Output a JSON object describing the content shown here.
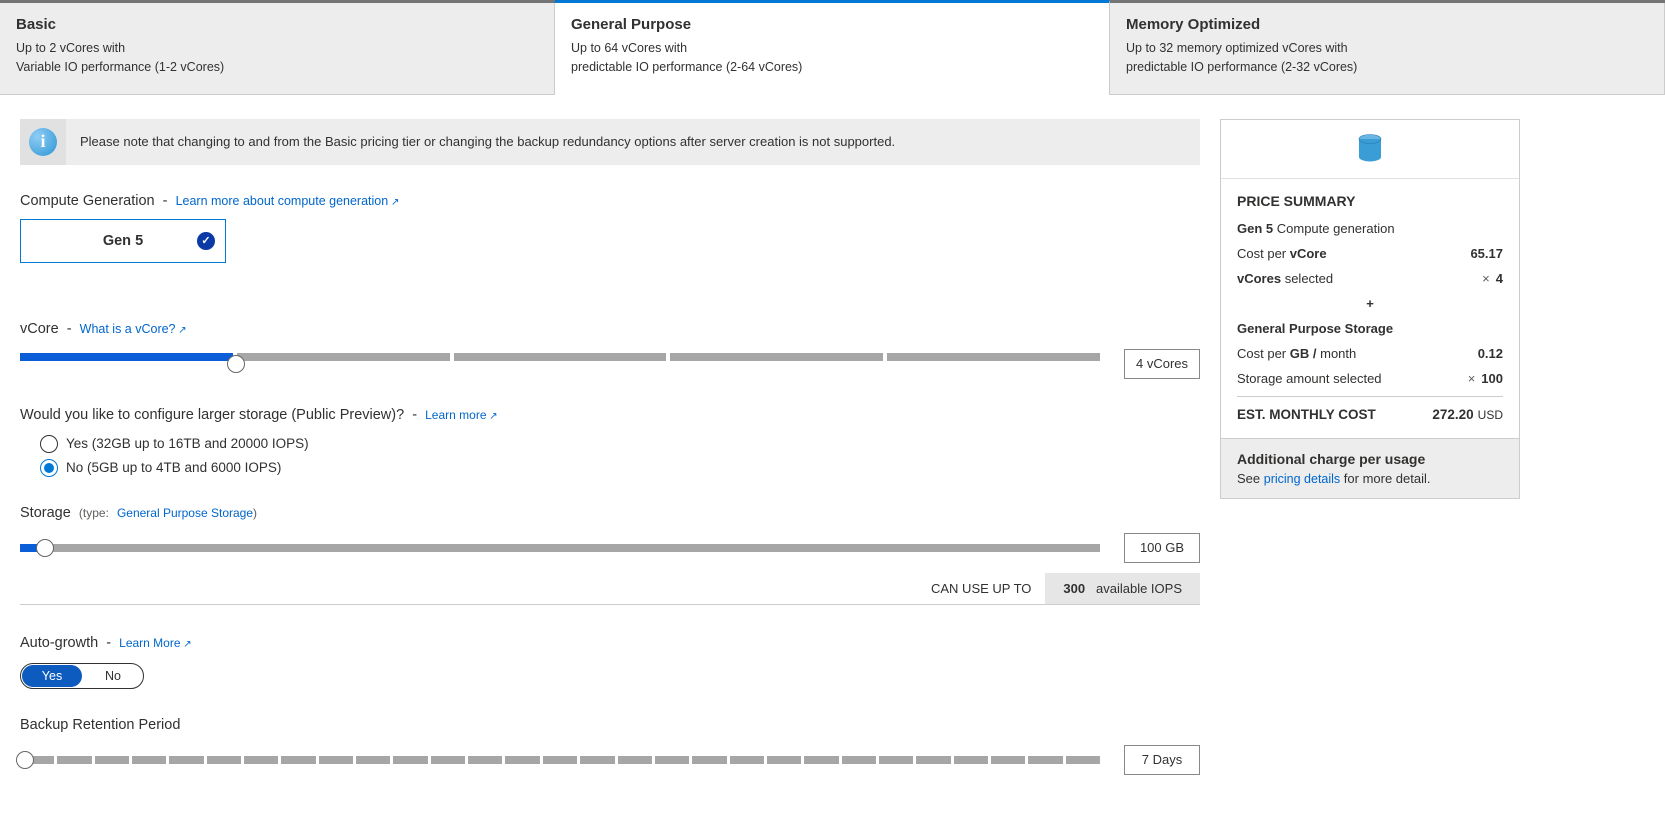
{
  "tiers": [
    {
      "title": "Basic",
      "line1": "Up to 2 vCores with",
      "line2": "Variable IO performance (1-2 vCores)",
      "active": false
    },
    {
      "title": "General Purpose",
      "line1": "Up to 64 vCores with",
      "line2": "predictable IO performance (2-64 vCores)",
      "active": true
    },
    {
      "title": "Memory Optimized",
      "line1": "Up to 32 memory optimized vCores with",
      "line2": "predictable IO performance (2-32 vCores)",
      "active": false
    }
  ],
  "info_notice": "Please note that changing to and from the Basic pricing tier or changing the backup redundancy options after server creation is not supported.",
  "compute_gen": {
    "label": "Compute Generation",
    "link": "Learn more about compute generation",
    "selected": "Gen 5"
  },
  "vcore": {
    "label": "vCore",
    "link": "What is a vCore?",
    "value_display": "4 vCores",
    "segments": 5,
    "filled_segments": 1,
    "thumb_pct": 20
  },
  "large_storage": {
    "label": "Would you like to configure larger storage (Public Preview)?",
    "link": "Learn more",
    "options": [
      {
        "label": "Yes (32GB up to 16TB and 20000 IOPS)",
        "checked": false
      },
      {
        "label": "No (5GB up to 4TB and 6000 IOPS)",
        "checked": true
      }
    ]
  },
  "storage": {
    "label": "Storage",
    "type_prefix": "(type:",
    "type_link": "General Purpose Storage",
    "type_suffix": ")",
    "value_display": "100 GB",
    "fill_pct": 2.3,
    "iops_prefix": "CAN USE UP TO",
    "iops_value": "300",
    "iops_suffix": "available IOPS"
  },
  "auto_growth": {
    "label": "Auto-growth",
    "link": "Learn More",
    "yes": "Yes",
    "no": "No"
  },
  "backup": {
    "label": "Backup Retention Period",
    "value_display": "7 Days",
    "segments": 29
  },
  "price": {
    "title": "PRICE SUMMARY",
    "gen_label_bold": "Gen 5",
    "gen_label_rest": "Compute generation",
    "cost_per_vcore_label_pre": "Cost per ",
    "cost_per_vcore_label_bold": "vCore",
    "cost_per_vcore_value": "65.17",
    "vcores_selected_label_bold": "vCores",
    "vcores_selected_label_rest": "selected",
    "vcores_selected_value": "4",
    "storage_section": "General Purpose Storage",
    "cost_per_gb_label_pre": "Cost per ",
    "cost_per_gb_label_bold": "GB /",
    "cost_per_gb_label_rest": "month",
    "cost_per_gb_value": "0.12",
    "storage_amount_label": "Storage amount selected",
    "storage_amount_value": "100",
    "est_label": "EST. MONTHLY COST",
    "est_value": "272.20",
    "est_currency": "USD",
    "foot_title": "Additional charge per usage",
    "foot_pre": "See ",
    "foot_link": "pricing details",
    "foot_post": " for more detail."
  }
}
